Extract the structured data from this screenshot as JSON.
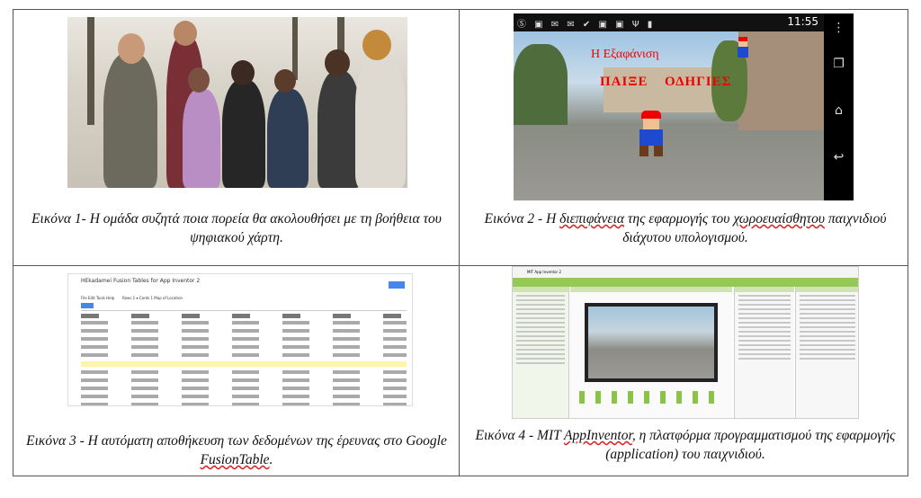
{
  "figures": [
    {
      "caption_prefix": "Εικόνα 1- ",
      "caption_text": "Η ομάδα συζητά ποια πορεία θα ακολουθήσει με τη βοήθεια του ψηφιακού χάρτη."
    },
    {
      "caption_prefix": "Εικόνα 2 - Η ",
      "caption_sq1": "διεπιφάνεια",
      "caption_mid": " της εφαρμογής του ",
      "caption_sq2": "χωροευαίσθητου",
      "caption_end": " παιχνιδιού διάχυτου υπολογισμού."
    },
    {
      "caption_prefix": "Εικόνα 3 - Η αυτόματη αποθήκευση των δεδομένων της έρευνας στο Google ",
      "caption_sq1": "FusionTable",
      "caption_end": "."
    },
    {
      "caption_prefix": "Εικόνα 4 - MIT ",
      "caption_sq1": "AppInventor",
      "caption_end": ", η πλατφόρμα προγραμματισμού της εφαρμογής (application) του παιχνιδιού."
    }
  ],
  "game": {
    "time": "11:55",
    "title": "Η Εξαφάνιση",
    "play_label": "ΠΑΙΞΕ",
    "guide_label": "ΟΔΗΓΙΕΣ"
  },
  "fusion": {
    "title": "HEkadamei Fusion Tables for App Inventor 2",
    "menu": "File  Edit  Tools  Help",
    "tabs": "Rows 1 ▾   Cards 1   Map of Location"
  },
  "appinventor": {
    "title": "MIT App Inventor 2"
  },
  "icons": [
    "mario-icon",
    "home-icon",
    "back-icon",
    "recent-apps-icon",
    "menu-dots-icon"
  ],
  "colors": {
    "game_text": "#e00000",
    "squiggle": "#d22222",
    "ai_green": "#95c857"
  }
}
